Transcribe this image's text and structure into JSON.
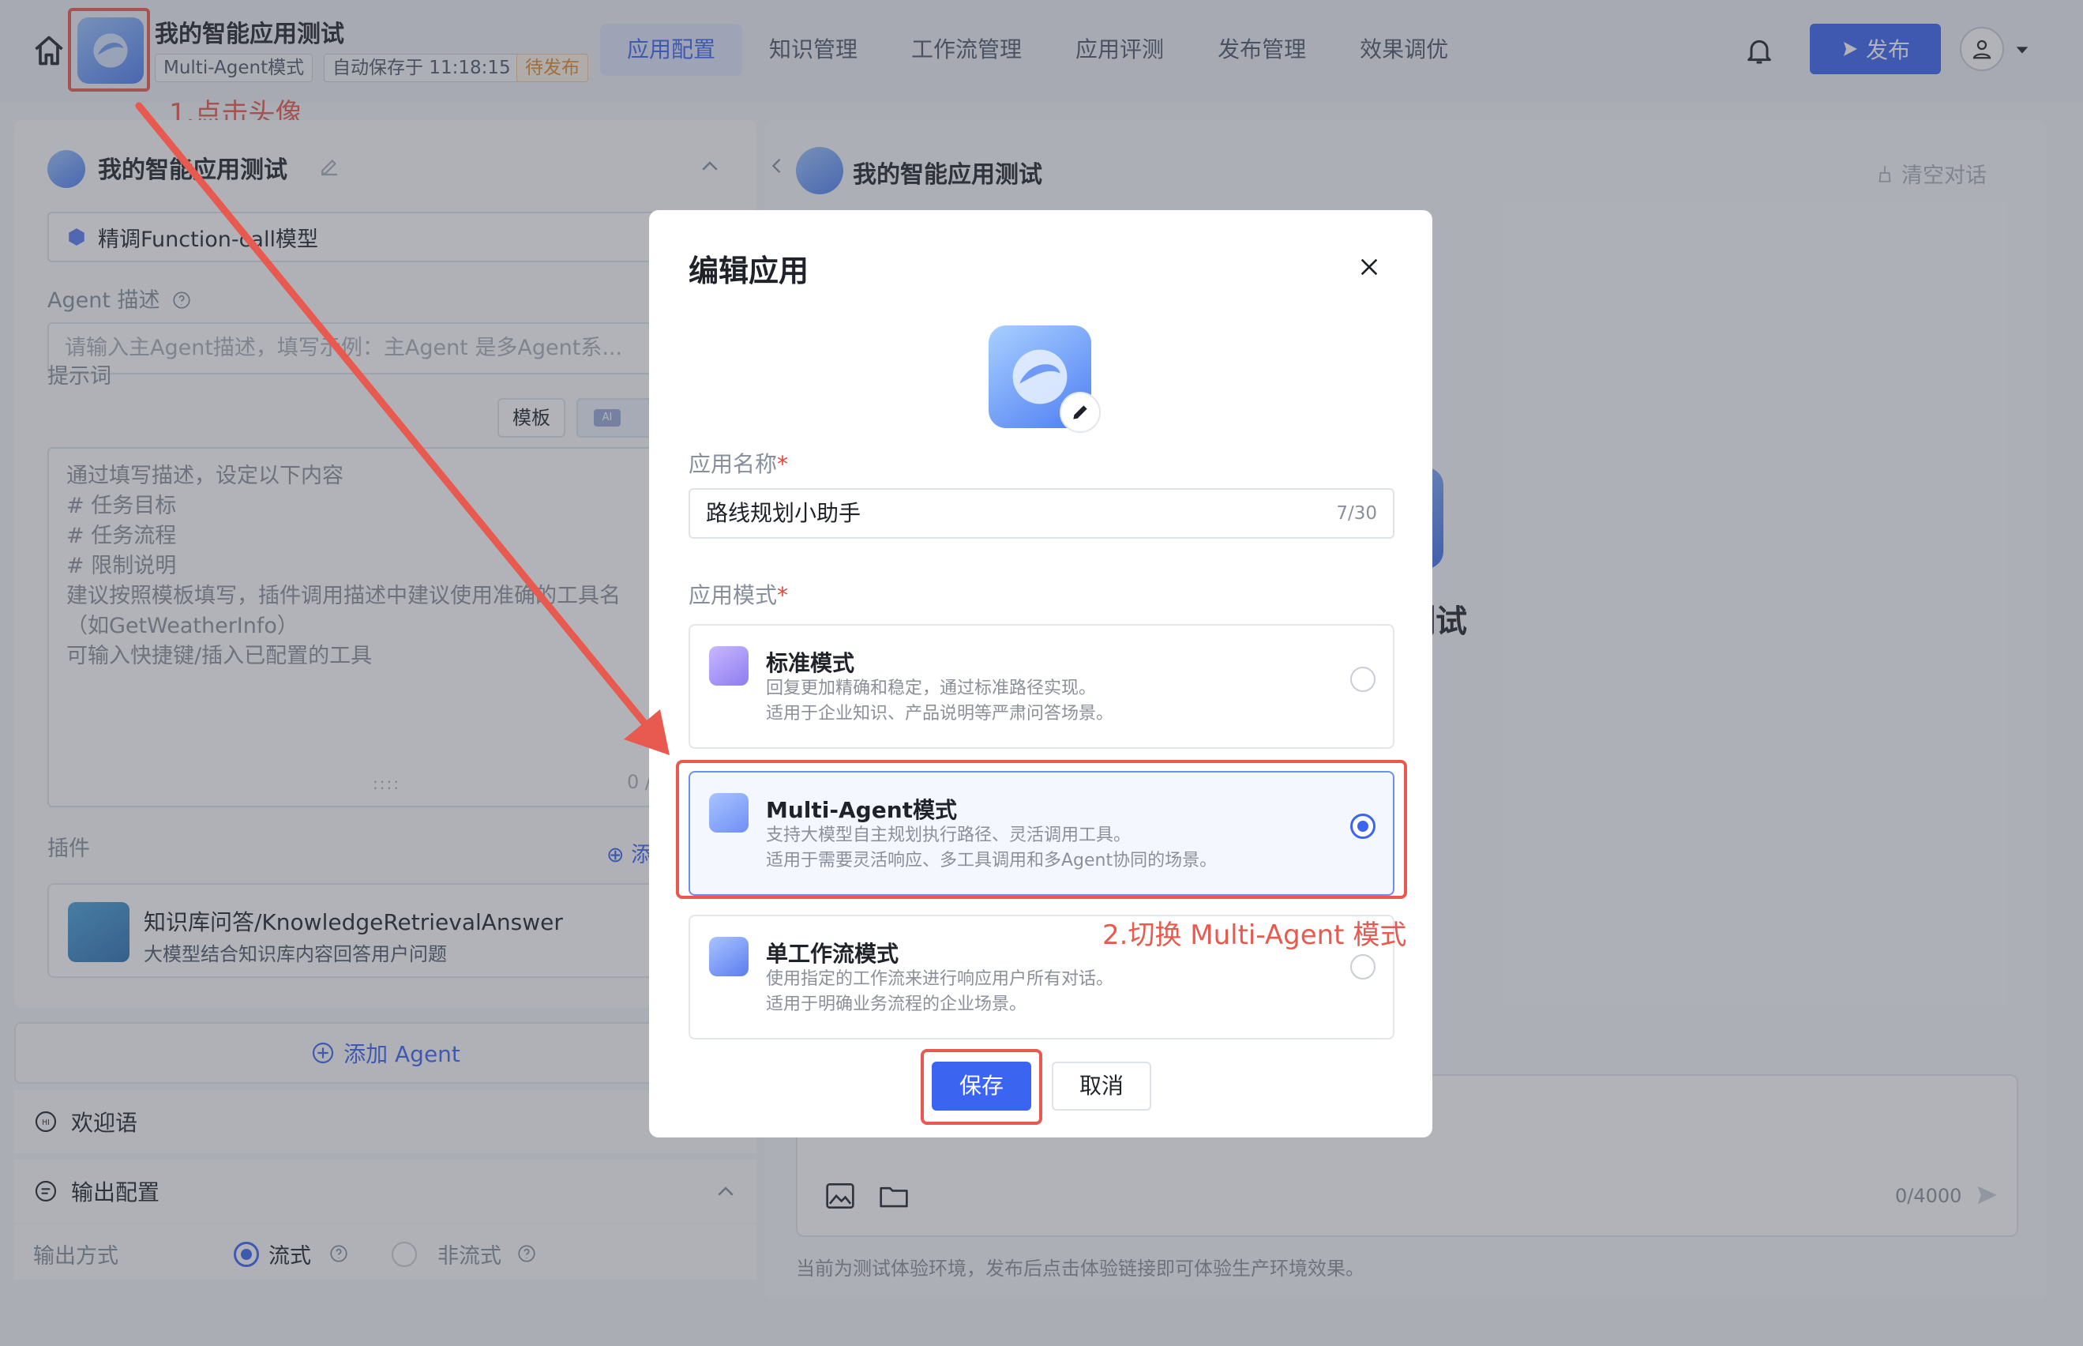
{
  "topbar": {
    "app_title": "我的智能应用测试",
    "mode_tag": "Multi-Agent模式",
    "autosave_tag": "自动保存于 11:18:15",
    "status_tag": "待发布",
    "nav": [
      {
        "label": "应用配置",
        "active": true
      },
      {
        "label": "知识管理",
        "active": false
      },
      {
        "label": "工作流管理",
        "active": false
      },
      {
        "label": "应用评测",
        "active": false
      },
      {
        "label": "发布管理",
        "active": false
      },
      {
        "label": "效果调优",
        "active": false
      }
    ],
    "publish_label": "发布"
  },
  "annotations": {
    "step1": "1.点击头像",
    "step2": "2.切换 Multi-Agent 模式"
  },
  "left_panel": {
    "title": "我的智能应用测试",
    "model": "精调Function-call模型",
    "agent_desc_label": "Agent 描述",
    "agent_desc_placeholder": "请输入主Agent描述，填写示例：主Agent 是多Agent系...",
    "prompt_label": "提示词",
    "template_label": "模板",
    "ai_badge": "AI",
    "prompt_placeholder": [
      "通过填写描述，设定以下内容",
      "# 任务目标",
      "# 任务流程",
      "# 限制说明",
      "建议按照模板填写，插件调用描述中建议使用准确的工具名",
      "（如GetWeatherInfo）",
      "可输入快捷键/插入已配置的工具"
    ],
    "prompt_counter": "0 /",
    "plugins_label": "插件",
    "plugin_add_label": "添",
    "plugin": {
      "name": "知识库问答/KnowledgeRetrievalAnswer",
      "desc": "大模型结合知识库内容回答用户问题"
    },
    "add_agent_label": "添加 Agent",
    "welcome_label": "欢迎语",
    "output_config_label": "输出配置",
    "output_mode_label": "输出方式",
    "output_options": [
      {
        "label": "流式",
        "selected": true
      },
      {
        "label": "非流式",
        "selected": false
      }
    ]
  },
  "right_panel": {
    "title": "我的智能应用测试",
    "clear_label": "清空对话",
    "big_title": "应用测试",
    "chat_counter": "0/4000",
    "footer_note": "当前为测试体验环境，发布后点击体验链接即可体验生产环境效果。"
  },
  "modal": {
    "title": "编辑应用",
    "name_label": "应用名称",
    "name_value": "路线规划小助手",
    "name_counter": "7/30",
    "mode_label": "应用模式",
    "required_mark": "*",
    "modes": [
      {
        "name": "标准模式",
        "desc1": "回复更加精确和稳定，通过标准路径实现。",
        "desc2": "适用于企业知识、产品说明等严肃问答场景。",
        "selected": false
      },
      {
        "name": "Multi-Agent模式",
        "desc1": "支持大模型自主规划执行路径、灵活调用工具。",
        "desc2": "适用于需要灵活响应、多工具调用和多Agent协同的场景。",
        "selected": true
      },
      {
        "name": "单工作流模式",
        "desc1": "使用指定的工作流来进行响应用户所有对话。",
        "desc2": "适用于明确业务流程的企业场景。",
        "selected": false
      }
    ],
    "save_label": "保存",
    "cancel_label": "取消"
  },
  "colors": {
    "accent": "#3b64f1",
    "annotation": "#e85a4f",
    "pending": "#e08a2e"
  }
}
